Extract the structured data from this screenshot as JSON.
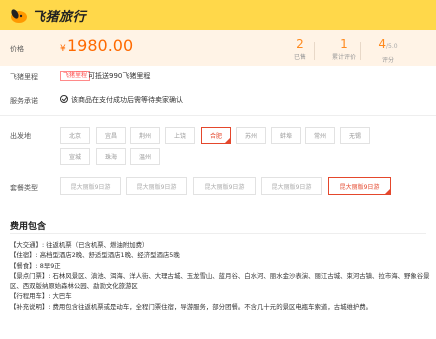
{
  "brand": {
    "name": "飞猪旅行"
  },
  "price_row": {
    "label": "价格",
    "currency": "¥",
    "amount": "1980.00",
    "stats": [
      {
        "value": "2",
        "suffix": "",
        "caption": "已售"
      },
      {
        "value": "1",
        "suffix": "",
        "caption": "累计评价"
      },
      {
        "value": "4",
        "suffix": "/5.0",
        "caption": "评分"
      }
    ]
  },
  "mileage": {
    "label": "飞猪里程",
    "badge": "飞猪里程",
    "text": "可抵送990飞猪里程"
  },
  "service": {
    "label": "服务承诺",
    "text": "该商品在支付成功后需等待卖家确认"
  },
  "departure": {
    "label": "出发地",
    "cities": [
      "北京",
      "宜昌",
      "荆州",
      "上饶",
      "合肥",
      "苏州",
      "蚌埠",
      "常州",
      "无锡",
      "宣城",
      "珠海",
      "温州"
    ],
    "selected_index": 4
  },
  "package": {
    "label": "套餐类型",
    "options": [
      "昆大丽版9日游",
      "昆大丽版9日游",
      "昆大丽版9日游",
      "昆大丽版9日游",
      "昆大丽版9日游"
    ],
    "selected_index": 4
  },
  "fee": {
    "title": "费用包含",
    "lines": [
      "【大交通】: 往返机票（已含机票、燃油附加费）",
      "【住宿】: 高档型酒店2晚、舒适型酒店1晚、经济型酒店5晚",
      "【餐食】: 8早9正",
      "【景点门票】: 石林风景区、滇池、洱海、洋人街、大理古城、玉龙雪山、蓝月谷、白水河、丽水金沙表演、丽江古城、束河古镇、拉市海、野象谷景区、西双版纳原始森林公园、勐泐文化旅游区",
      "【行程用车】: 大巴车",
      "【补充说明】: 费用包含往返机票或是动车，全程门票住宿，导游服务，部分团餐。不含几十元的景区电瓶车索道，古城维护费。"
    ]
  },
  "colors": {
    "brand_yellow": "#ffd84a",
    "price_orange": "#ff6a00",
    "select_red": "#e4472c"
  },
  "icons": {
    "logo": "fliggy-logo-icon",
    "check": "check-circle-icon",
    "corner": "selected-corner-icon"
  }
}
